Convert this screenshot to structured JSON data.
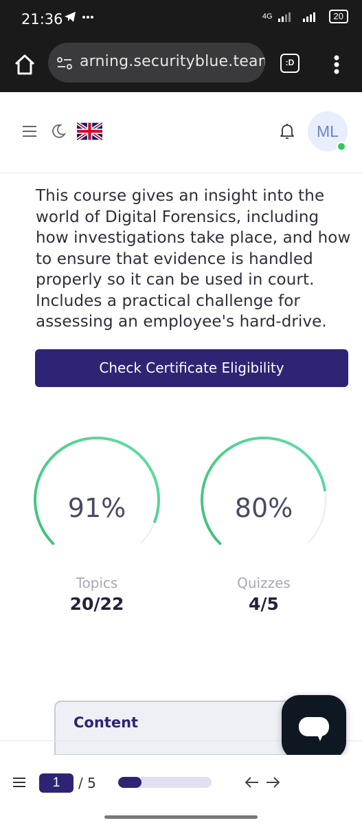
{
  "status_bar": {
    "time": "21:36",
    "network": "4G",
    "battery": "20"
  },
  "browser": {
    "url": "arning.securityblue.team",
    "tab_label": ":D"
  },
  "header": {
    "avatar_initials": "ML",
    "colors": {
      "accent": "#2e2474",
      "online": "#2ec95c"
    }
  },
  "course": {
    "description": "This course gives an insight into the world of Digital Forensics, including how investigations take place, and how to ensure that evidence is handled properly so it can be used in court. Includes a practical challenge for assessing an employee's hard-drive.",
    "eligibility_button": "Check Certificate Eligibility"
  },
  "stats": {
    "topics": {
      "percent": 91,
      "percent_label": "91%",
      "label": "Topics",
      "count": "20/22"
    },
    "quizzes": {
      "percent": 80,
      "percent_label": "80%",
      "label": "Quizzes",
      "count": "4/5"
    }
  },
  "content_tab": {
    "label": "Content"
  },
  "pager": {
    "current": "1",
    "total": "/ 5",
    "progress": 0.25
  },
  "icons": [
    "home-icon",
    "site-settings-icon",
    "tabs-icon",
    "more-vert-icon",
    "hamburger-icon",
    "moon-icon",
    "uk-flag-icon",
    "bell-icon",
    "chat-icon",
    "arrow-left-icon",
    "arrow-right-icon"
  ]
}
